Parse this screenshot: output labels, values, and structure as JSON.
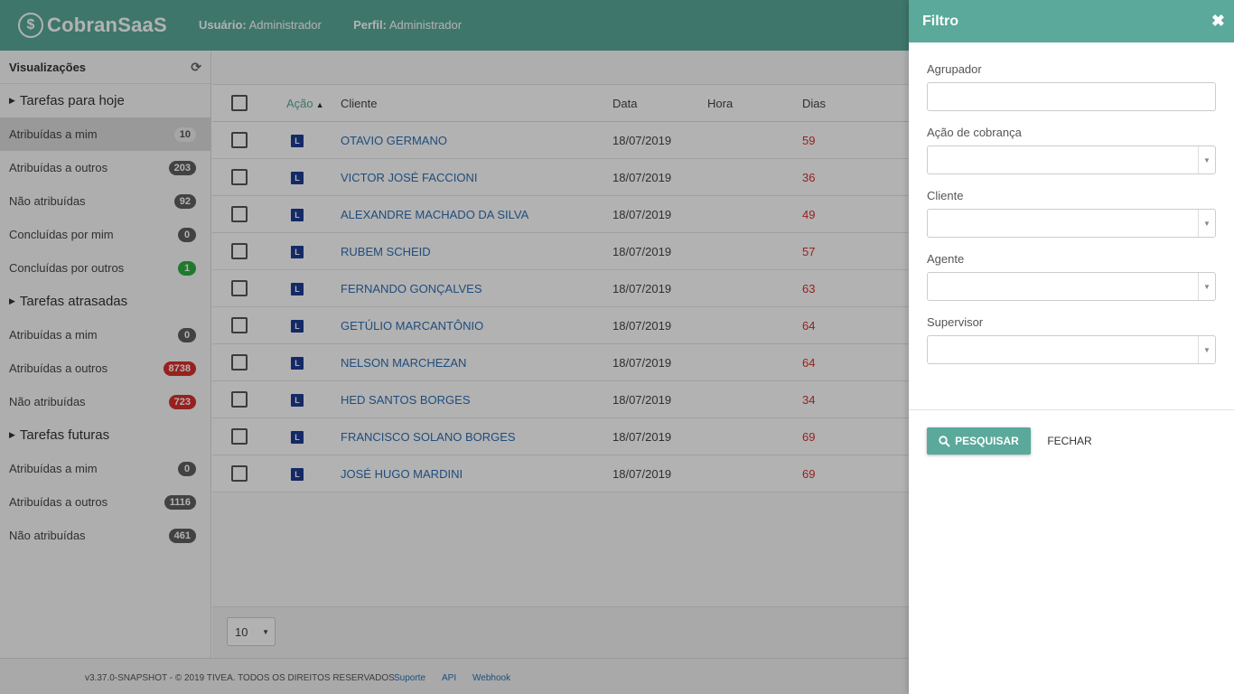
{
  "header": {
    "logo_text": "CobranSaaS",
    "logo_symbol": "$",
    "user_label": "Usuário:",
    "user_value": "Administrador",
    "profile_label": "Perfil:",
    "profile_value": "Administrador",
    "color": "#5aa99a"
  },
  "sidebar": {
    "title": "Visualizações",
    "groups": [
      {
        "label": "Tarefas para hoje",
        "items": [
          {
            "label": "Atribuídas a mim",
            "count": "10"
          },
          {
            "label": "Atribuídas a outros",
            "count": "203"
          },
          {
            "label": "Não atribuídas",
            "count": "92"
          },
          {
            "label": "Concluídas por mim",
            "count": "0"
          },
          {
            "label": "Concluídas por outros",
            "count": "1"
          }
        ]
      },
      {
        "label": "Tarefas atrasadas",
        "items": [
          {
            "label": "Atribuídas a mim",
            "count": "0"
          },
          {
            "label": "Atribuídas a outros",
            "count": "8738"
          },
          {
            "label": "Não atribuídas",
            "count": "723"
          }
        ]
      },
      {
        "label": "Tarefas futuras",
        "items": [
          {
            "label": "Atribuídas a mim",
            "count": "0"
          },
          {
            "label": "Atribuídas a outros",
            "count": "1116"
          },
          {
            "label": "Não atribuídas",
            "count": "461"
          }
        ]
      }
    ]
  },
  "table": {
    "columns": [
      "Ação",
      "Cliente",
      "Data",
      "Hora",
      "Dias"
    ],
    "action_tag": "L",
    "rows": [
      {
        "cliente": "OTAVIO GERMANO",
        "data": "18/07/2019",
        "hora": "",
        "dias": "59"
      },
      {
        "cliente": "VICTOR JOSÉ FACCIONI",
        "data": "18/07/2019",
        "hora": "",
        "dias": "36"
      },
      {
        "cliente": "ALEXANDRE MACHADO DA SILVA",
        "data": "18/07/2019",
        "hora": "",
        "dias": "49"
      },
      {
        "cliente": "RUBEM SCHEID",
        "data": "18/07/2019",
        "hora": "",
        "dias": "57"
      },
      {
        "cliente": "FERNANDO GONÇALVES",
        "data": "18/07/2019",
        "hora": "",
        "dias": "63"
      },
      {
        "cliente": "GETÚLIO MARCANTÔNIO",
        "data": "18/07/2019",
        "hora": "",
        "dias": "64"
      },
      {
        "cliente": "NELSON MARCHEZAN",
        "data": "18/07/2019",
        "hora": "",
        "dias": "64"
      },
      {
        "cliente": "HED SANTOS BORGES",
        "data": "18/07/2019",
        "hora": "",
        "dias": "34"
      },
      {
        "cliente": "FRANCISCO SOLANO BORGES",
        "data": "18/07/2019",
        "hora": "",
        "dias": "69"
      },
      {
        "cliente": "JOSÉ HUGO MARDINI",
        "data": "18/07/2019",
        "hora": "",
        "dias": "69"
      }
    ]
  },
  "pager": {
    "page_size": "10"
  },
  "footer": {
    "version": "v3.37.0-SNAPSHOT - © 2019 TIVEA. TODOS OS DIREITOS RESERVADOS.",
    "links": [
      "Suporte",
      "API",
      "Webhook"
    ]
  },
  "filter_panel": {
    "title": "Filtro",
    "fields": [
      {
        "label": "Agrupador",
        "type": "text",
        "value": ""
      },
      {
        "label": "Ação de cobrança",
        "type": "select",
        "value": ""
      },
      {
        "label": "Cliente",
        "type": "select",
        "value": ""
      },
      {
        "label": "Agente",
        "type": "select",
        "value": ""
      },
      {
        "label": "Supervisor",
        "type": "select",
        "value": ""
      }
    ],
    "search_label": "PESQUISAR",
    "close_label": "FECHAR"
  }
}
